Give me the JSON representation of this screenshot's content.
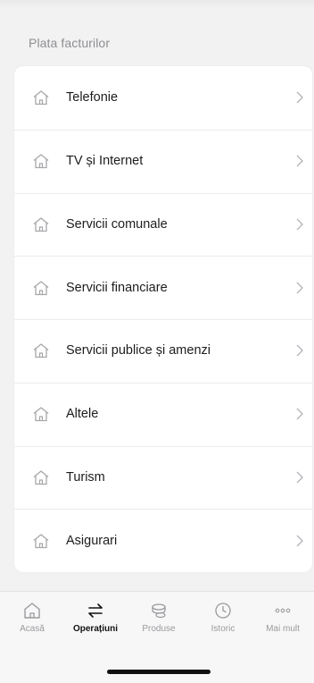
{
  "section": {
    "title": "Plata facturilor"
  },
  "list": {
    "items": [
      {
        "label": "Telefonie",
        "icon": "house-icon"
      },
      {
        "label": "TV și Internet",
        "icon": "house-icon"
      },
      {
        "label": "Servicii comunale",
        "icon": "house-icon"
      },
      {
        "label": "Servicii financiare",
        "icon": "house-icon"
      },
      {
        "label": "Servicii publice și amenzi",
        "icon": "house-icon"
      },
      {
        "label": "Altele",
        "icon": "house-icon"
      },
      {
        "label": "Turism",
        "icon": "house-icon"
      },
      {
        "label": "Asigurari",
        "icon": "house-icon"
      }
    ]
  },
  "tabbar": {
    "tabs": [
      {
        "label": "Acasă",
        "icon": "home-icon",
        "active": false
      },
      {
        "label": "Operațiuni",
        "icon": "transfer-arrows-icon",
        "active": true
      },
      {
        "label": "Produse",
        "icon": "coins-icon",
        "active": false
      },
      {
        "label": "Istoric",
        "icon": "clock-icon",
        "active": false
      },
      {
        "label": "Mai mult",
        "icon": "more-dots-icon",
        "active": false
      }
    ]
  },
  "colors": {
    "background": "#f2f2f2",
    "card": "#ffffff",
    "text": "#1c1c1e",
    "secondary_text": "#8e8e93",
    "icon_gray": "#9a9a9f",
    "active_tab": "#111111"
  }
}
